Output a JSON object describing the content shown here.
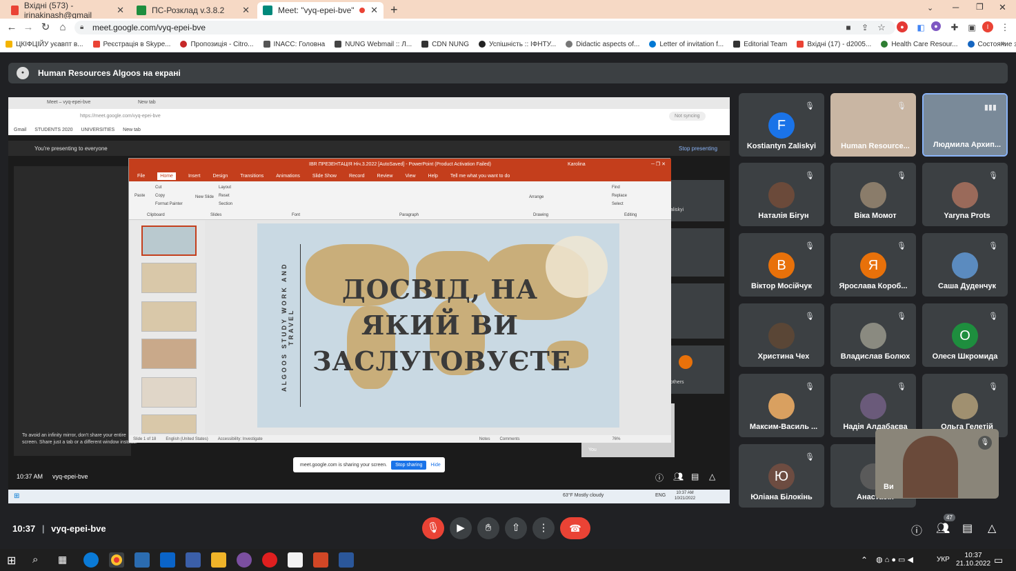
{
  "browser": {
    "tabs": [
      {
        "title": "Вхідні (573) - irinakinash@gmail",
        "color": "#ea4335"
      },
      {
        "title": "ПС-Розклад v.3.8.2",
        "color": "#1e8e3e"
      },
      {
        "title": "Meet: \"vyq-epei-bve\"",
        "color": "#00897b"
      }
    ],
    "url": "meet.google.com/vyq-epei-bve",
    "bookmarks": [
      "ЦКІФЦІЙУ уєавпт в...",
      "Реєстрація в Skype...",
      "Пропозиція - Citro...",
      "INACC: Головна",
      "NUNG Webmail :: Л...",
      "CDN NUNG",
      "Успішність :: ІФНТУ...",
      "Didactic aspects of...",
      "Letter of invitation f...",
      "Editorial Team",
      "Вхідні (17) - d2005...",
      "Health Care Resour...",
      "Состояние здоровья"
    ]
  },
  "meet": {
    "presenter_banner": "Human Resources Algoos на екрані",
    "time": "10:37",
    "meeting_code": "vyq-epei-bve",
    "participant_count": "47",
    "participants": [
      {
        "name": "Kostiantyn Zaliskyi",
        "initial": "F",
        "color": "#1a73e8"
      },
      {
        "name": "Human Resource...",
        "initial": "",
        "color": "#c9b6a3"
      },
      {
        "name": "Людмила Архип...",
        "initial": "",
        "color": "#7a8a99"
      },
      {
        "name": "Наталія Бігун",
        "initial": "",
        "color": "#6b4a3a"
      },
      {
        "name": "Віка Момот",
        "initial": "",
        "color": "#8a7c6a"
      },
      {
        "name": "Yaryna Prots",
        "initial": "",
        "color": "#9a6a5a"
      },
      {
        "name": "Віктор Мосійчук",
        "initial": "В",
        "color": "#e8710a"
      },
      {
        "name": "Ярослава Короб...",
        "initial": "Я",
        "color": "#e8710a"
      },
      {
        "name": "Саша Дуденчук",
        "initial": "",
        "color": "#5b8bbf"
      },
      {
        "name": "Христина Чех",
        "initial": "",
        "color": "#5a4636"
      },
      {
        "name": "Владислав Болюх",
        "initial": "",
        "color": "#8a8a80"
      },
      {
        "name": "Олеся Шкромида",
        "initial": "О",
        "color": "#1e8e3e"
      },
      {
        "name": "Максим-Василь ...",
        "initial": "",
        "color": "#d9a060"
      },
      {
        "name": "Надія Алдабаєва",
        "initial": "",
        "color": "#6a5a7a"
      },
      {
        "name": "Ольга Гелетій",
        "initial": "",
        "color": "#a09070"
      },
      {
        "name": "Юліана Білокінь",
        "initial": "Ю",
        "color": "#6d4c41"
      },
      {
        "name": "Анастасія",
        "initial": "",
        "color": "#5a5a5a"
      }
    ],
    "self_label": "Ви"
  },
  "shared_screen": {
    "inner_tabs": [
      "Meet – vyq-epei-bve",
      "New tab"
    ],
    "inner_url": "https://meet.google.com/vyq-epei-bve",
    "inner_sync": "Not syncing",
    "inner_bookmarks": [
      "Gmail",
      "STUDENTS 2020",
      "UNIVERSITIES",
      "New tab"
    ],
    "presenting_text": "You're presenting to everyone",
    "stop_presenting": "Stop presenting",
    "ppt_title": "IBR ПРЕЗЕНТАЦІЯ Ніч.3.2022 [AutoSaved] - PowerPoint (Product Activation Failed)",
    "ppt_user": "Karolina",
    "ppt_menu": [
      "File",
      "Home",
      "Insert",
      "Design",
      "Transitions",
      "Animations",
      "Slide Show",
      "Record",
      "Review",
      "View",
      "Help"
    ],
    "ppt_tell_me": "Tell me what you want to do",
    "ppt_groups": [
      "Clipboard",
      "Slides",
      "Font",
      "Paragraph",
      "Drawing",
      "Editing"
    ],
    "ppt_ribbon_buttons": [
      "Cut",
      "Copy",
      "Format Painter",
      "Layout",
      "Reset",
      "Section",
      "Find",
      "Replace",
      "Select",
      "Arrange",
      "Paste",
      "New Slide"
    ],
    "slide_title": "ДОСВІД, НА ЯКИЙ ВИ ЗАСЛУГОВУЄТЕ",
    "slide_vertical": "ALGOOS STUDY WORK AND TRAVEL",
    "ppt_status": [
      "Slide 1 of 18",
      "English (United States)",
      "Accessibility: Investigate",
      "Notes",
      "Comments",
      "76%"
    ],
    "mirror_warning": "To avoid an infinity mirror, don't share your entire screen. Share just a tab or a different window instead.",
    "sharing_text": "meet.google.com is sharing your screen.",
    "stop_sharing": "Stop sharing",
    "hide": "Hide",
    "inner_time": "10:37 AM",
    "inner_code": "vyq-epei-bve",
    "weather": "63°F Mostly cloudy",
    "inner_date": "10/21/2022",
    "inner_clock": "10:37 AM",
    "inner_lang": "ENG",
    "others": "others",
    "you": "You",
    "partial_name": "aliskyi"
  },
  "taskbar": {
    "lang": "УКР",
    "time": "10:37",
    "date": "21.10.2022"
  }
}
